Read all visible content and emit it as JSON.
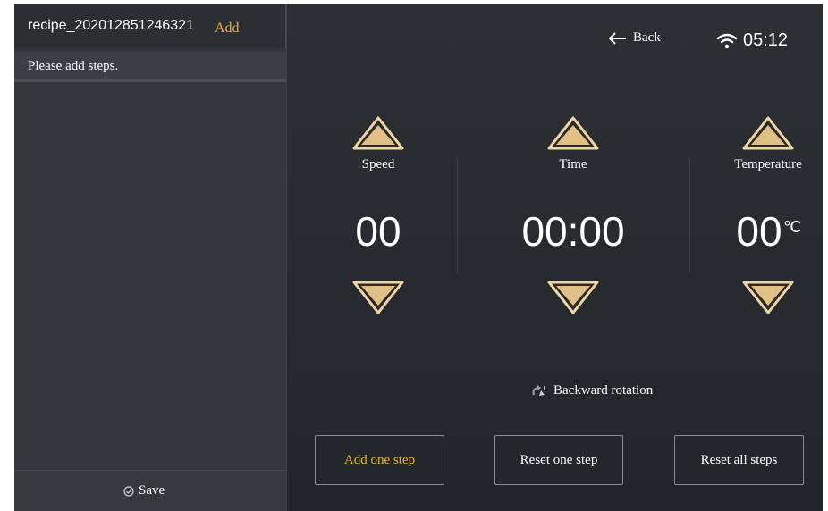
{
  "sidebar": {
    "recipe_name": "recipe_202012851246321",
    "add_label": "Add",
    "steps_message": "Please add steps.",
    "save_label": "Save"
  },
  "header": {
    "back_label": "Back",
    "clock": "05:12"
  },
  "controls": {
    "speed": {
      "label": "Speed",
      "value": "00"
    },
    "time": {
      "label": "Time",
      "value": "00:00"
    },
    "temperature": {
      "label": "Temperature",
      "value": "00",
      "unit": "℃"
    }
  },
  "rotation_label": "Backward rotation",
  "actions": {
    "add_step": "Add one step",
    "reset_step": "Reset one step",
    "reset_all": "Reset all steps"
  },
  "colors": {
    "accent": "#e9b425",
    "arrow_fill": "#e3c48c",
    "background": "#2a2e33"
  },
  "icons": {
    "back": "arrow-left-icon",
    "wifi": "wifi-icon",
    "save": "check-circle-icon",
    "rotation": "rotate-icon",
    "up": "triangle-up-icon",
    "down": "triangle-down-icon"
  }
}
